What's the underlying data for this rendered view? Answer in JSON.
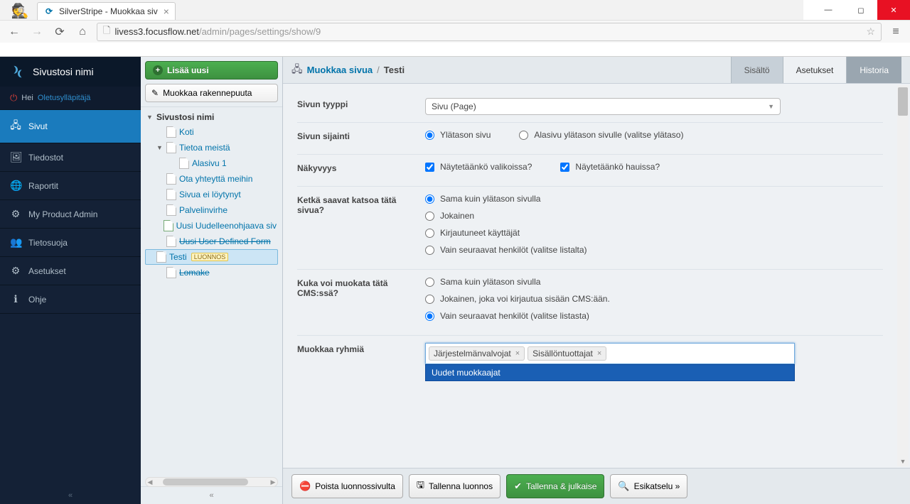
{
  "browser": {
    "tab_title": "SilverStripe - Muokkaa siv",
    "url_host": "livess3.focusflow.net",
    "url_path": "/admin/pages/settings/show/9"
  },
  "sidebar": {
    "site_name": "Sivustosi nimi",
    "greeting_prefix": "Hei",
    "greeting_user": "Oletusylläpitäjä",
    "items": [
      {
        "label": "Sivut",
        "icon": "sitemap"
      },
      {
        "label": "Tiedostot",
        "icon": "image"
      },
      {
        "label": "Raportit",
        "icon": "globe"
      },
      {
        "label": "My Product Admin",
        "icon": "gears"
      },
      {
        "label": "Tietosuoja",
        "icon": "people"
      },
      {
        "label": "Asetukset",
        "icon": "gear"
      },
      {
        "label": "Ohje",
        "icon": "info"
      }
    ]
  },
  "tree": {
    "btn_add": "Lisää uusi",
    "btn_edit": "Muokkaa rakennepuuta",
    "root": "Sivustosi nimi",
    "items": [
      {
        "label": "Koti",
        "indent": 1
      },
      {
        "label": "Tietoa meistä",
        "indent": 1,
        "expanded": true
      },
      {
        "label": "Alasivu 1",
        "indent": 2
      },
      {
        "label": "Ota yhteyttä meihin",
        "indent": 1
      },
      {
        "label": "Sivua ei löytynyt",
        "indent": 1
      },
      {
        "label": "Palvelinvirhe",
        "indent": 1
      },
      {
        "label": "Uusi Uudelleenohjaava siv",
        "indent": 1,
        "icon": "redirect"
      },
      {
        "label": "Uusi User Defined Form",
        "indent": 1,
        "strike": true
      },
      {
        "label": "Testi",
        "indent": 1,
        "selected": true,
        "badge": "LUONNOS"
      },
      {
        "label": "Lomake",
        "indent": 1,
        "strike": true
      }
    ]
  },
  "header": {
    "breadcrumb_parent": "Muokkaa sivua",
    "breadcrumb_current": "Testi",
    "tabs": {
      "content": "Sisältö",
      "settings": "Asetukset",
      "history": "Historia"
    }
  },
  "form": {
    "page_type": {
      "label": "Sivun tyyppi",
      "value": "Sivu (Page)"
    },
    "location": {
      "label": "Sivun sijainti",
      "opt1": "Ylätason sivu",
      "opt2": "Alasivu ylätason sivulle (valitse ylätaso)"
    },
    "visibility": {
      "label": "Näkyvyys",
      "opt1": "Näytetäänkö valikoissa?",
      "opt2": "Näytetäänkö hauissa?"
    },
    "viewers": {
      "label": "Ketkä saavat katsoa tätä sivua?",
      "opt1": "Sama kuin ylätason sivulla",
      "opt2": "Jokainen",
      "opt3": "Kirjautuneet käyttäjät",
      "opt4": "Vain seuraavat henkilöt (valitse listalta)"
    },
    "editors": {
      "label": "Kuka voi muokata tätä CMS:ssä?",
      "opt1": "Sama kuin ylätason sivulla",
      "opt2": "Jokainen, joka voi kirjautua sisään CMS:ään.",
      "opt3": "Vain seuraavat henkilöt (valitse listasta)"
    },
    "groups": {
      "label": "Muokkaa ryhmiä",
      "tokens": [
        "Järjestelmänvalvojat",
        "Sisällöntuottajat"
      ],
      "dropdown_option": "Uudet muokkaajat"
    }
  },
  "footer": {
    "delete": "Poista luonnossivulta",
    "save_draft": "Tallenna luonnos",
    "publish": "Tallenna & julkaise",
    "preview": "Esikatselu »"
  }
}
